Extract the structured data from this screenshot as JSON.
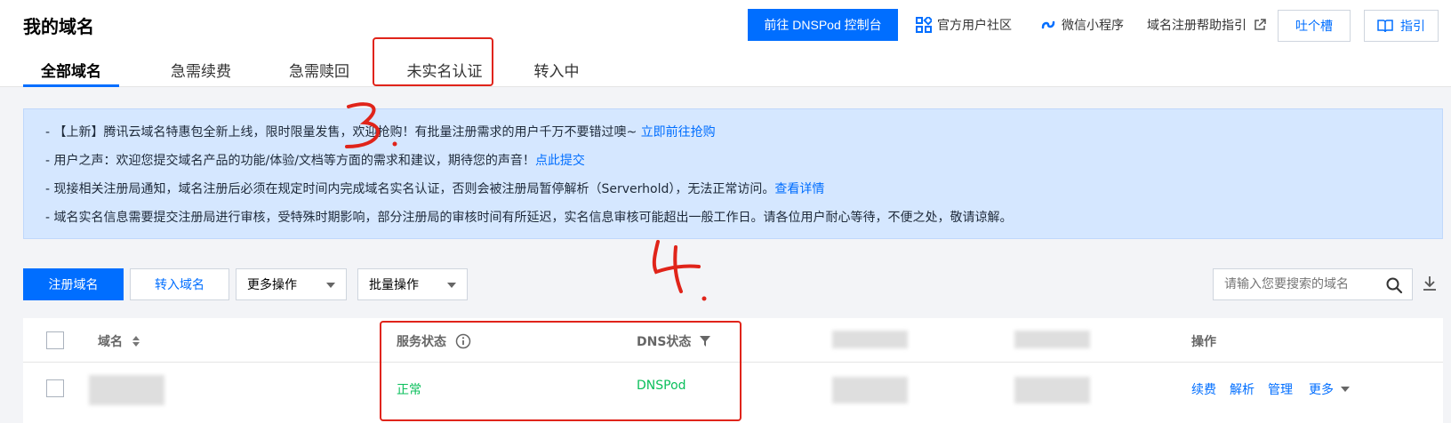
{
  "header": {
    "title": "我的域名",
    "dnspod_button": "前往 DNSPod 控制台",
    "community": "官方用户社区",
    "mini_program": "微信小程序",
    "help_guide": "域名注册帮助指引",
    "feedback": "吐个槽",
    "guide": "指引"
  },
  "tabs": [
    {
      "label": "全部域名",
      "active": true
    },
    {
      "label": "急需续费",
      "active": false
    },
    {
      "label": "急需赎回",
      "active": false
    },
    {
      "label": "未实名认证",
      "active": false
    },
    {
      "label": "转入中",
      "active": false
    }
  ],
  "notice": {
    "line1_text": "- 【上新】腾讯云域名特惠包全新上线，限时限量发售，欢迎抢购！有批量注册需求的用户千万不要错过噢~ ",
    "line1_link": "立即前往抢购",
    "line2_text": "- 用户之声：欢迎您提交域名产品的功能/体验/文档等方面的需求和建议，期待您的声音！",
    "line2_link": "点此提交",
    "line3_text": "- 现接相关注册局通知，域名注册后必须在规定时间内完成域名实名认证，否则会被注册局暂停解析（Serverhold），无法正常访问。",
    "line3_link": "查看详情",
    "line4_text": "- 域名实名信息需要提交注册局进行审核，受特殊时期影响，部分注册局的审核时间有所延迟，实名信息审核可能超出一般工作日。请各位用户耐心等待，不便之处，敬请谅解。"
  },
  "toolbar": {
    "register": "注册域名",
    "transfer_in": "转入域名",
    "more_actions": "更多操作",
    "batch_actions": "批量操作",
    "search_placeholder": "请输入您要搜索的域名"
  },
  "table": {
    "columns": {
      "domain": "域名",
      "service_status": "服务状态",
      "dns_status": "DNS状态",
      "actions": "操作"
    },
    "rows": [
      {
        "service_status": "正常",
        "dns_status": "DNSPod",
        "actions": [
          "续费",
          "解析",
          "管理",
          "更多"
        ]
      }
    ]
  },
  "annotations": [
    "3.",
    "4."
  ],
  "colors": {
    "primary": "#006eff",
    "success": "#0abf5b",
    "annotation": "#e0241a",
    "notice_bg": "#d5e7ff"
  }
}
